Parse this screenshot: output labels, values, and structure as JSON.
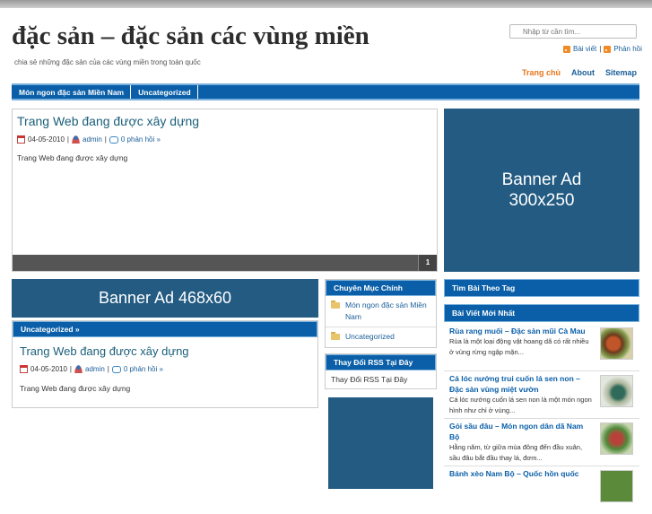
{
  "header": {
    "site_title": "đặc sản – đặc sản các vùng miền",
    "tagline": "chia sẻ những đặc sản của các vùng miền trong toàn quốc",
    "search_placeholder": "Nhập từ cần tìm...",
    "rss_posts": "Bài viết",
    "rss_separator": "|",
    "rss_comments": "Phản hồi"
  },
  "top_nav": [
    {
      "label": "Trang chủ",
      "active": true
    },
    {
      "label": "About",
      "active": false
    },
    {
      "label": "Sitemap",
      "active": false
    }
  ],
  "category_bar": [
    "Món ngon đặc sản Miền Nam",
    "Uncategorized"
  ],
  "featured": {
    "title": "Trang Web đang được xây dựng",
    "date": "04-05-2010",
    "author": "admin",
    "comments": "0 phản hồi »",
    "excerpt": "Trang Web đang được xây dựng",
    "slide_number": "1"
  },
  "banner_300": {
    "line1": "Banner Ad",
    "line2": "300x250"
  },
  "banner_468": "Banner Ad 468x60",
  "section_label": "Uncategorized »",
  "post": {
    "title": "Trang Web đang được xây dựng",
    "date": "04-05-2010",
    "author": "admin",
    "comments": "0 phản hồi »",
    "excerpt": "Trang Web đang được xây dựng"
  },
  "sep": "|",
  "widgets": {
    "categories_title": "Chuyên Mục Chính",
    "categories": [
      "Món ngon đặc sản Miền Nam",
      "Uncategorized"
    ],
    "rss_title": "Thay Đổi RSS Tại Đây",
    "rss_text": "Thay Đổi RSS Tại Đây",
    "tags_title": "Tìm Bài Theo Tag",
    "recent_title": "Bài Viết Mới Nhất"
  },
  "recent_posts": [
    {
      "title": "Rùa rang muối – Đặc sản mũi Cà Mau",
      "excerpt": "Rùa là một loại động vật hoang dã có rất nhiều ở vùng rừng ngập mặn..."
    },
    {
      "title": "Cá lóc nướng trui cuốn lá sen non – Đặc sản vùng miệt vườn",
      "excerpt": "Cá lóc nướng cuốn lá sen non là một món ngon hình như chỉ ở vùng..."
    },
    {
      "title": "Gỏi sầu đâu – Món ngon dân dã Nam Bộ",
      "excerpt": "Hằng năm, từ giữa mùa đông đến đầu xuân, sầu đâu bắt đầu thay lá, đơm..."
    },
    {
      "title": "Bánh xèo Nam Bộ – Quốc hồn quốc",
      "excerpt": ""
    }
  ],
  "colors": {
    "nav_blue": "#0a5fa8",
    "banner_blue": "#235b82",
    "active_orange": "#e8761b"
  }
}
